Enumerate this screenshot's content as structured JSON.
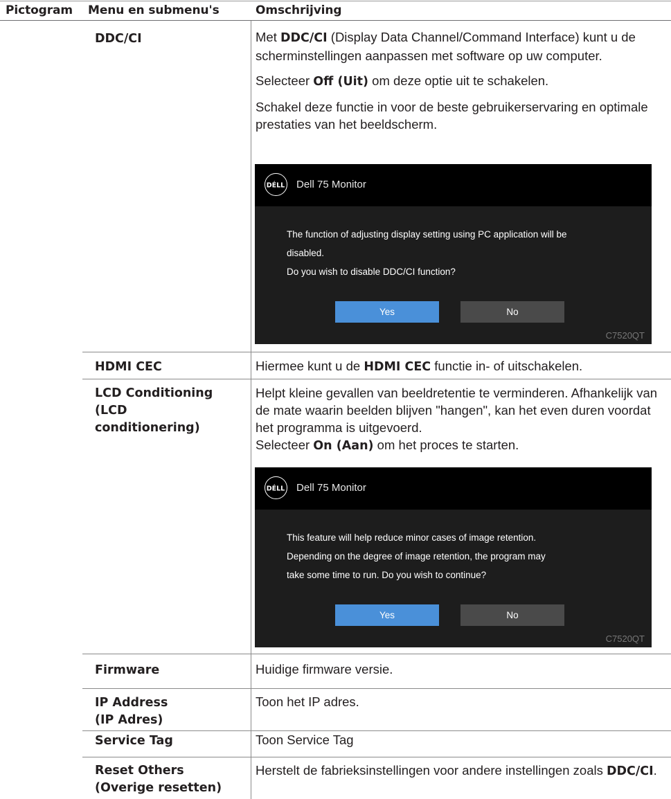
{
  "header": {
    "col1": "Pictogram",
    "col2": "Menu en submenu's",
    "col3": "Omschrijving"
  },
  "rows": {
    "ddcci": {
      "menu": "DDC/CI",
      "p1_pre": "Met ",
      "p1_bold": "DDC/CI",
      "p1_post": " (Display Data Channel/Command Interface) kunt u de scherminstellingen aanpassen met software op uw computer.",
      "p2_pre": "Selecteer ",
      "p2_bold": "Off (Uit)",
      "p2_post": " om deze optie uit te schakelen.",
      "p3": "Schakel deze functie in voor de beste gebruikerservaring en optimale prestaties van het beeldscherm.",
      "dialog": {
        "logo": "DÉLL",
        "title": "Dell 75 Monitor",
        "lines": [
          "The function of adjusting display setting using PC application will be",
          "disabled.",
          "Do you wish to disable DDC/CI function?"
        ],
        "yes": "Yes",
        "no": "No",
        "model": "C7520QT"
      }
    },
    "hdmi": {
      "menu": "HDMI CEC",
      "pre": "Hiermee kunt u de ",
      "bold": "HDMI CEC",
      "post": " functie in- of uitschakelen."
    },
    "lcd": {
      "menu_lines": [
        "LCD Conditioning",
        "(LCD",
        "conditionering)"
      ],
      "p1": "Helpt kleine gevallen van beeldretentie te verminderen. Afhankelijk van de mate waarin beelden blijven \"hangen\", kan het even duren voordat het programma is uitgevoerd.",
      "p2_pre": "Selecteer ",
      "p2_bold": "On (Aan)",
      "p2_post": " om het proces te starten.",
      "dialog": {
        "logo": "DÉLL",
        "title": "Dell 75 Monitor",
        "lines": [
          "This feature will help reduce minor cases of image retention.",
          "Depending on the degree of image retention, the program may",
          "take some time to run. Do you wish to continue?"
        ],
        "yes": "Yes",
        "no": "No",
        "model": "C7520QT"
      }
    },
    "firmware": {
      "menu": "Firmware",
      "desc": "Huidige firmware versie."
    },
    "ip": {
      "menu_lines": [
        "IP Address",
        "(IP Adres)"
      ],
      "desc": "Toon het IP adres."
    },
    "service": {
      "menu": "Service Tag",
      "desc": "Toon Service Tag"
    },
    "reset": {
      "menu_lines": [
        "Reset Others",
        "(Overige resetten)"
      ],
      "pre": "Herstelt de fabrieksinstellingen voor andere instellingen zoals ",
      "bold": "DDC/CI",
      "post": "."
    }
  }
}
